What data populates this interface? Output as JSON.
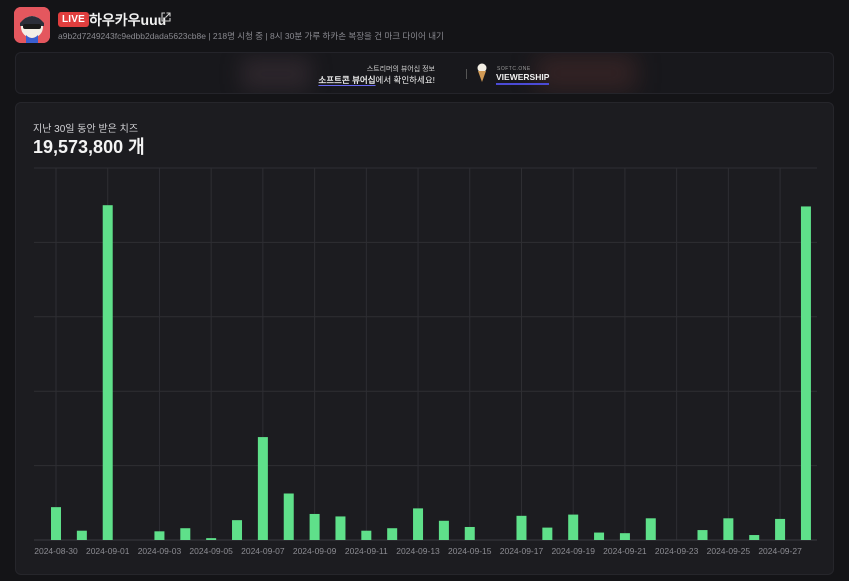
{
  "header": {
    "live_label": "LIVE",
    "channel_name": "하우카우uuu",
    "sub_line": "a9b2d7249243fc9edbb2dada5623cb8e | 218명 시청 중 | 8시 30분 가루 하카손 복장을 건 마크 다이어 내기",
    "avatar_icon": "avatar-image",
    "external_link_icon": "external-link-icon"
  },
  "banner": {
    "line1": "스트리머의 뷰어십 정보",
    "line2_highlight": "소프트콘 뷰어십",
    "line2_rest": "에서 확인하세요!",
    "brand_small": "SOFTC.ONE",
    "brand_big": "VIEWERSHIP"
  },
  "card": {
    "label": "지난 30일 동안 받은 치즈",
    "total": "19,573,800 개"
  },
  "colors": {
    "bar": "#5fe08a",
    "background": "#141417",
    "card": "#1c1c20",
    "grid": "#2e2e33",
    "live": "#e03e3e"
  },
  "chart_data": {
    "type": "bar",
    "x": [
      "2024-08-30",
      "2024-08-31",
      "2024-09-01",
      "2024-09-02",
      "2024-09-03",
      "2024-09-04",
      "2024-09-05",
      "2024-09-06",
      "2024-09-07",
      "2024-09-08",
      "2024-09-09",
      "2024-09-10",
      "2024-09-11",
      "2024-09-12",
      "2024-09-13",
      "2024-09-14",
      "2024-09-15",
      "2024-09-16",
      "2024-09-17",
      "2024-09-18",
      "2024-09-19",
      "2024-09-20",
      "2024-09-21",
      "2024-09-22",
      "2024-09-23",
      "2024-09-24",
      "2024-09-25",
      "2024-09-26",
      "2024-09-27",
      "2024-09-28"
    ],
    "tick_labels": [
      "2024-08-30",
      "2024-09-01",
      "2024-09-03",
      "2024-09-05",
      "2024-09-07",
      "2024-09-09",
      "2024-09-11",
      "2024-09-13",
      "2024-09-15",
      "2024-09-17",
      "2024-09-19",
      "2024-09-21",
      "2024-09-23",
      "2024-09-25",
      "2024-09-27"
    ],
    "values": [
      530000,
      150000,
      5400000,
      0,
      140000,
      190000,
      30000,
      320000,
      1660000,
      750000,
      420000,
      380000,
      150000,
      190000,
      510000,
      310000,
      210000,
      0,
      390000,
      200000,
      410000,
      120000,
      110000,
      350000,
      0,
      160000,
      350000,
      80000,
      340000,
      5380000
    ],
    "ylim": [
      0,
      6000000
    ],
    "grid": true
  }
}
